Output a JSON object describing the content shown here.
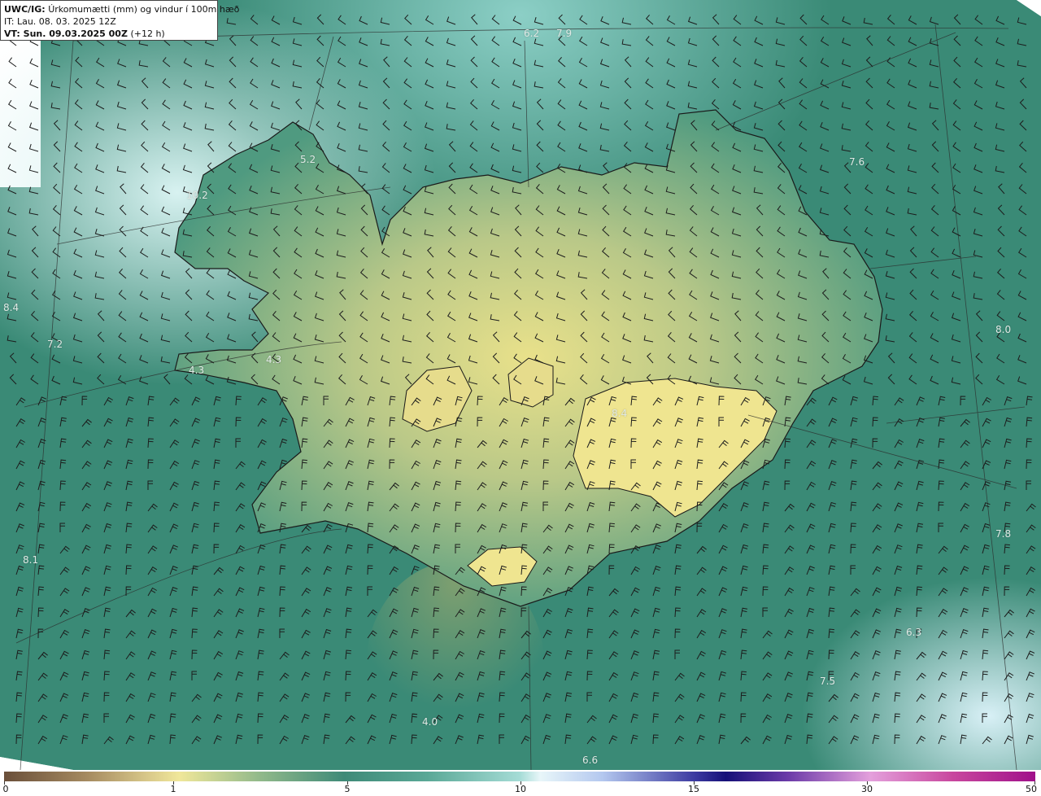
{
  "info": {
    "title_prefix": "UWC/IG:",
    "title_text": "Úrkomumætti (mm) og vindur í 100m hæð",
    "it_line": "IT: Lau. 08. 03. 2025 12Z",
    "vt_prefix": "VT: Sun. 09.03.2025 00Z",
    "vt_suffix": "(+12 h)"
  },
  "map_labels": [
    "6.2",
    "7.9",
    "5.2",
    "10.2",
    "7.6",
    "8.4",
    "7.2",
    "8.0",
    "4.3",
    "4.3",
    "8.4",
    "8.1",
    "7.8",
    "6.3",
    "7.5",
    "4.0",
    "6.6"
  ],
  "colorbar": {
    "ticks": [
      "0",
      "1",
      "5",
      "10",
      "15",
      "30",
      "50"
    ]
  },
  "colors": {
    "sea_dark": "#2f7e6c",
    "sea_light": "#a5dcd6",
    "land_low": "#3f8a78",
    "land_high": "#e8e08a"
  }
}
